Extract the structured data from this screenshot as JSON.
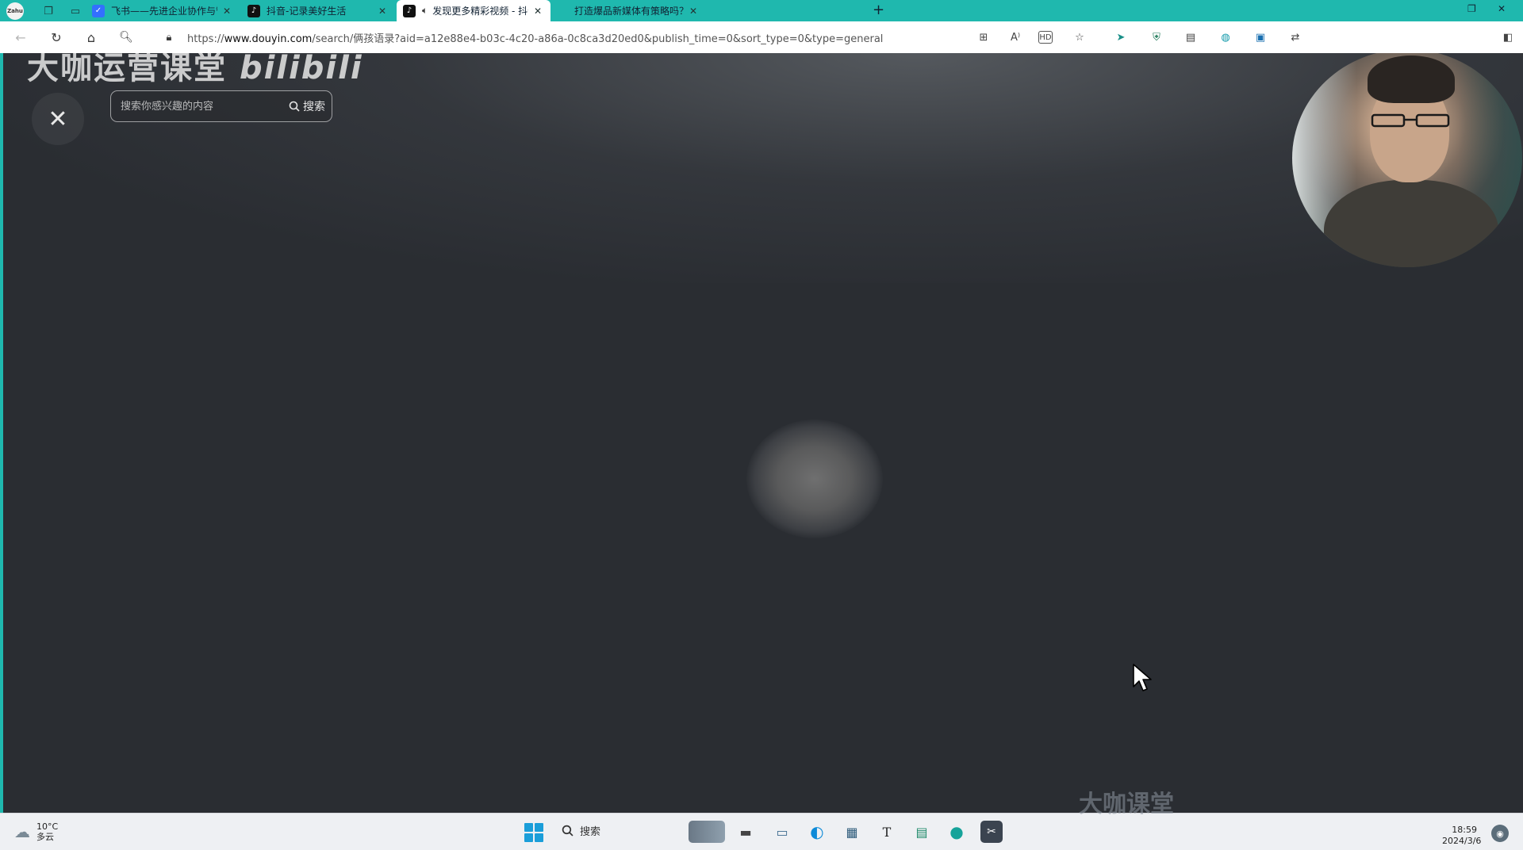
{
  "browser": {
    "tabs": [
      {
        "title": "飞书——先进企业协作与管理平",
        "favicon": "feishu-icon"
      },
      {
        "title": "抖音-记录美好生活",
        "favicon": "douyin-icon"
      },
      {
        "title": "发现更多精彩视频 - 抖音搜",
        "favicon": "douyin-icon",
        "active": true,
        "audio": "speaker-icon"
      },
      {
        "title": "打造爆品新媒体有策略吗？新媒",
        "favicon": ""
      }
    ],
    "close_glyph": "✕",
    "newtab_glyph": "+",
    "url": {
      "scheme": "https://",
      "host": "www.douyin.com",
      "path": "/search/俩孩语录?aid=a12e88e4-b03c-4c20-a86a-0c8ca3d20ed0&publish_time=0&sort_type=0&type=general"
    }
  },
  "page": {
    "watermark_top": "大咖运营课堂",
    "watermark_logo": "bilibili",
    "close_glyph": "✕",
    "search": {
      "placeholder": "搜索你感兴趣的内容",
      "button_label": "搜索"
    }
  },
  "taskbar": {
    "weather_temp": "10°C",
    "weather_desc": "多云",
    "search_label": "搜索",
    "watermark_bottom": "大咖课堂",
    "time": "18:59",
    "date": "2024/3/6"
  },
  "colors": {
    "tab_strip": "#1fb8ae",
    "page_bg": "#2a2d32",
    "taskbar_bg": "#eef0f3"
  }
}
